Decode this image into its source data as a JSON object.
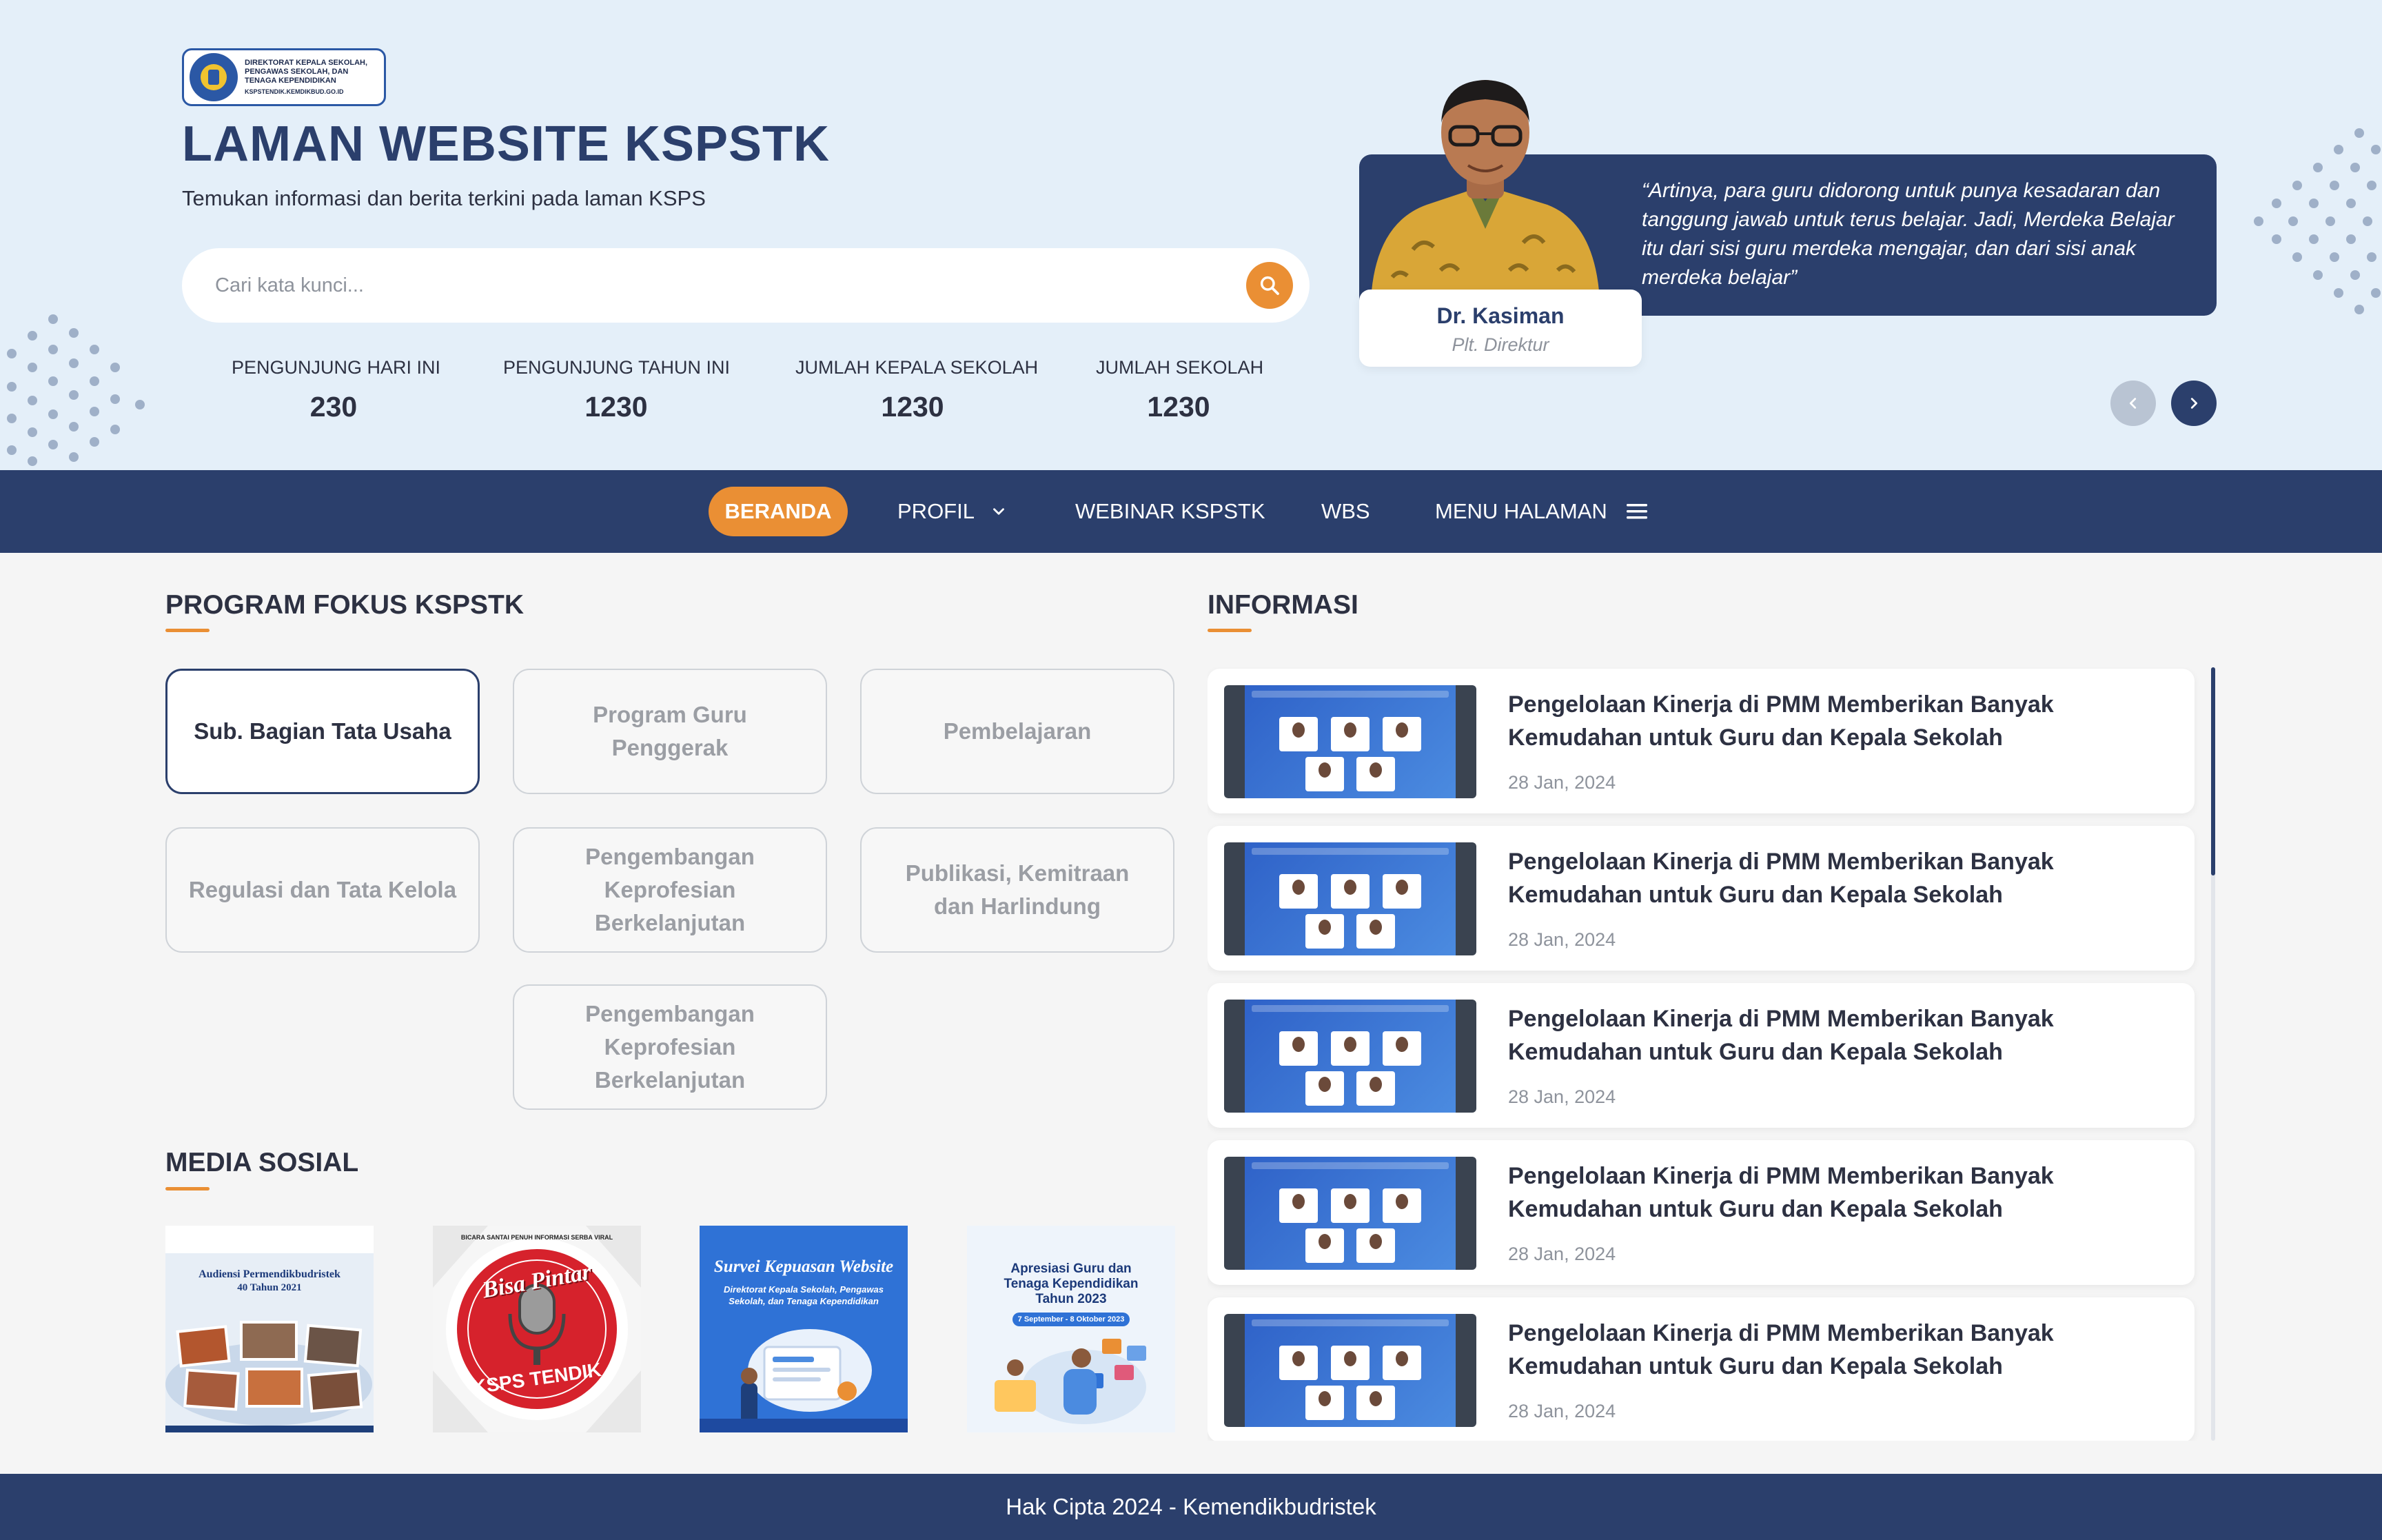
{
  "logo": {
    "lines": [
      "DIREKTORAT KEPALA SEKOLAH,",
      "PENGAWAS SEKOLAH, DAN",
      "TENAGA KEPENDIDIKAN"
    ],
    "url": "KSPSTENDIK.KEMDIKBUD.GO.ID"
  },
  "hero": {
    "title": "LAMAN WEBSITE KSPSTK",
    "subtitle": "Temukan informasi dan berita terkini pada laman KSPS"
  },
  "search": {
    "placeholder": "Cari kata kunci...",
    "value": ""
  },
  "stats": [
    {
      "label": "PENGUNJUNG HARI INI",
      "value": "230"
    },
    {
      "label": "PENGUNJUNG TAHUN INI",
      "value": "1230"
    },
    {
      "label": "JUMLAH KEPALA SEKOLAH",
      "value": "1230"
    },
    {
      "label": "JUMLAH SEKOLAH",
      "value": "1230"
    }
  ],
  "testimonial": {
    "quote": "“Artinya, para guru didorong untuk punya kesadaran dan tanggung jawab untuk terus belajar. Jadi, Merdeka Belajar itu dari sisi guru merdeka mengajar, dan dari sisi anak merdeka belajar”",
    "name": "Dr. Kasiman",
    "role": "Plt. Direktur"
  },
  "nav": {
    "items": [
      {
        "label": "BERANDA",
        "active": true
      },
      {
        "label": "PROFIL",
        "icon": "chevron-down-icon"
      },
      {
        "label": "WEBINAR KSPSTK"
      },
      {
        "label": "WBS"
      },
      {
        "label": "MENU HALAMAN",
        "icon": "hamburger-menu-icon"
      }
    ]
  },
  "program": {
    "title": "PROGRAM FOKUS KSPSTK",
    "items": [
      {
        "label": "Sub. Bagian Tata Usaha",
        "active": true
      },
      {
        "label": "Program Guru Penggerak"
      },
      {
        "label": "Pembelajaran"
      },
      {
        "label": "Regulasi dan Tata Kelola"
      },
      {
        "label": "Pengembangan Keprofesian Berkelanjutan"
      },
      {
        "label": "Publikasi, Kemitraan dan Harlindung"
      },
      {
        "label": "Pengembangan Keprofesian Berkelanjutan"
      }
    ]
  },
  "media": {
    "title": "MEDIA SOSIAL",
    "posts": [
      {
        "title": "Audiensi Permendikbudristek",
        "subtitle": "40 Tahun 2021"
      },
      {
        "title": "Bisa Pintar",
        "subtitle": "KSPS TENDIK",
        "ring": "BICARA SANTAI PENUH INFORMASI SERBA VIRAL"
      },
      {
        "title": "Survei Kepuasan Website",
        "subtitle": "Direktorat Kepala Sekolah, Pengawas Sekolah, dan Tenaga Kependidikan"
      },
      {
        "title": "Apresiasi Guru dan Tenaga Kependidikan Tahun 2023",
        "subtitle": "7 September - 8 Oktober 2023"
      }
    ]
  },
  "informasi": {
    "title": "INFORMASI",
    "items": [
      {
        "title": "Pengelolaan Kinerja di PMM Memberikan Banyak Kemudahan untuk Guru dan Kepala Sekolah",
        "date": "28 Jan, 2024"
      },
      {
        "title": "Pengelolaan Kinerja di PMM Memberikan Banyak Kemudahan untuk Guru dan Kepala Sekolah",
        "date": "28 Jan, 2024"
      },
      {
        "title": "Pengelolaan Kinerja di PMM Memberikan Banyak Kemudahan untuk Guru dan Kepala Sekolah",
        "date": "28 Jan, 2024"
      },
      {
        "title": "Pengelolaan Kinerja di PMM Memberikan Banyak Kemudahan untuk Guru dan Kepala Sekolah",
        "date": "28 Jan, 2024"
      },
      {
        "title": "Pengelolaan Kinerja di PMM Memberikan Banyak Kemudahan untuk Guru dan Kepala Sekolah",
        "date": "28 Jan, 2024"
      }
    ]
  },
  "footer": {
    "text": "Hak Cipta 2024 - Kemendikbudristek"
  },
  "colors": {
    "primary": "#2b3f6c",
    "accent": "#ea8f34",
    "hero_bg": "#e4eff9",
    "page_bg": "#f5f5f5"
  }
}
